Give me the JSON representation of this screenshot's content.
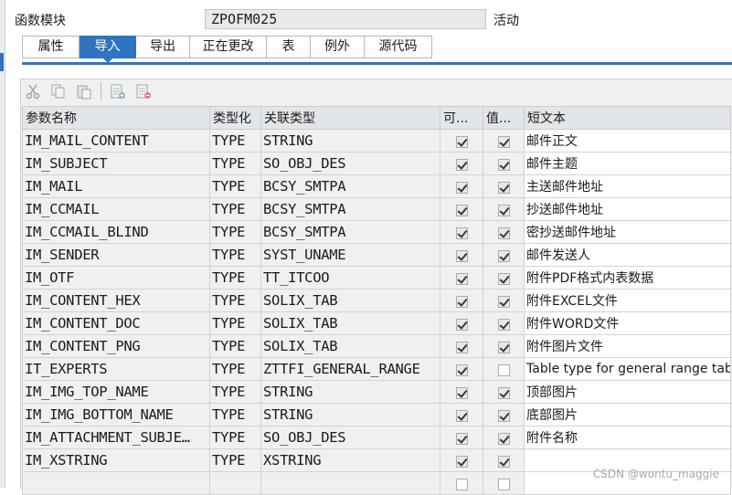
{
  "header": {
    "label": "函数模块",
    "module_name": "ZPOFM025",
    "status": "活动"
  },
  "tabs": [
    {
      "label": "属性",
      "active": false
    },
    {
      "label": "导入",
      "active": true
    },
    {
      "label": "导出",
      "active": false
    },
    {
      "label": "正在更改",
      "active": false
    },
    {
      "label": "表",
      "active": false
    },
    {
      "label": "例外",
      "active": false
    },
    {
      "label": "源代码",
      "active": false
    }
  ],
  "toolbar": {
    "icons": [
      "cut-icon",
      "copy-icon",
      "paste-icon",
      "insert-row-icon",
      "delete-row-icon"
    ]
  },
  "table": {
    "columns": [
      "参数名称",
      "类型化",
      "关联类型",
      "可...",
      "值...",
      "短文本"
    ],
    "rows": [
      {
        "name": "IM_MAIL_CONTENT",
        "typing": "TYPE",
        "ref_type": "STRING",
        "optional": true,
        "pass_value": true,
        "text": "邮件正文"
      },
      {
        "name": "IM_SUBJECT",
        "typing": "TYPE",
        "ref_type": "SO_OBJ_DES",
        "optional": true,
        "pass_value": true,
        "text": "邮件主题"
      },
      {
        "name": "IM_MAIL",
        "typing": "TYPE",
        "ref_type": "BCSY_SMTPA",
        "optional": true,
        "pass_value": true,
        "text": "主送邮件地址"
      },
      {
        "name": "IM_CCMAIL",
        "typing": "TYPE",
        "ref_type": "BCSY_SMTPA",
        "optional": true,
        "pass_value": true,
        "text": "抄送邮件地址"
      },
      {
        "name": "IM_CCMAIL_BLIND",
        "typing": "TYPE",
        "ref_type": "BCSY_SMTPA",
        "optional": true,
        "pass_value": true,
        "text": "密抄送邮件地址"
      },
      {
        "name": "IM_SENDER",
        "typing": "TYPE",
        "ref_type": "SYST_UNAME",
        "optional": true,
        "pass_value": true,
        "text": "邮件发送人"
      },
      {
        "name": "IM_OTF",
        "typing": "TYPE",
        "ref_type": "TT_ITCOO",
        "optional": true,
        "pass_value": true,
        "text": "附件PDF格式内表数据"
      },
      {
        "name": "IM_CONTENT_HEX",
        "typing": "TYPE",
        "ref_type": "SOLIX_TAB",
        "optional": true,
        "pass_value": true,
        "text": "附件EXCEL文件"
      },
      {
        "name": "IM_CONTENT_DOC",
        "typing": "TYPE",
        "ref_type": "SOLIX_TAB",
        "optional": true,
        "pass_value": true,
        "text": "附件WORD文件"
      },
      {
        "name": "IM_CONTENT_PNG",
        "typing": "TYPE",
        "ref_type": "SOLIX_TAB",
        "optional": true,
        "pass_value": true,
        "text": "附件图片文件"
      },
      {
        "name": "IT_EXPERTS",
        "typing": "TYPE",
        "ref_type": "ZTTFI_GENERAL_RANGE",
        "optional": true,
        "pass_value": false,
        "text": "Table type for general range table"
      },
      {
        "name": "IM_IMG_TOP_NAME",
        "typing": "TYPE",
        "ref_type": "STRING",
        "optional": true,
        "pass_value": true,
        "text": "顶部图片"
      },
      {
        "name": "IM_IMG_BOTTOM_NAME",
        "typing": "TYPE",
        "ref_type": "STRING",
        "optional": true,
        "pass_value": true,
        "text": "底部图片"
      },
      {
        "name": "IM_ATTACHMENT_SUBJE…",
        "typing": "TYPE",
        "ref_type": "SO_OBJ_DES",
        "optional": true,
        "pass_value": true,
        "text": "附件名称"
      },
      {
        "name": "IM_XSTRING",
        "typing": "TYPE",
        "ref_type": "XSTRING",
        "optional": true,
        "pass_value": true,
        "text": ""
      },
      {
        "name": "",
        "typing": "",
        "ref_type": "",
        "optional": false,
        "pass_value": false,
        "text": ""
      }
    ]
  },
  "watermark": "CSDN @wontu_maggie",
  "colors": {
    "accent": "#2f74c0",
    "grid_bg": "#f0f0f0",
    "header_bg": "#e3e6e9"
  }
}
